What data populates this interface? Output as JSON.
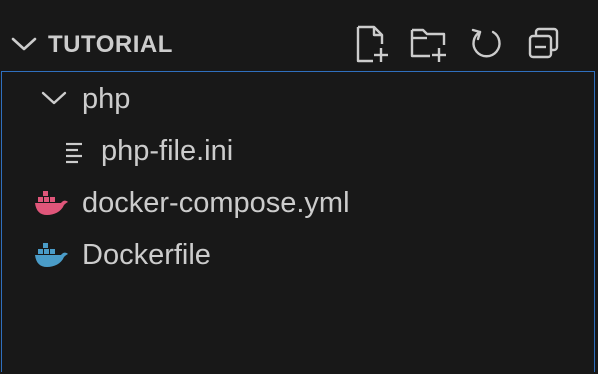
{
  "section": {
    "title": "TUTORIAL",
    "expanded": true
  },
  "toolbar": {
    "actions": [
      {
        "name": "new-file",
        "icon": "new-file-icon"
      },
      {
        "name": "new-folder",
        "icon": "new-folder-icon"
      },
      {
        "name": "refresh",
        "icon": "refresh-icon"
      },
      {
        "name": "collapse-all",
        "icon": "collapse-all-icon"
      }
    ]
  },
  "tree": {
    "items": [
      {
        "label": "php",
        "type": "folder",
        "expanded": true,
        "icon": "chevron-down-icon"
      },
      {
        "label": "php-file.ini",
        "type": "file",
        "icon": "ini-file-icon"
      },
      {
        "label": "docker-compose.yml",
        "type": "file",
        "icon": "docker-compose-icon",
        "icon_color": "#e0567a"
      },
      {
        "label": "Dockerfile",
        "type": "file",
        "icon": "docker-icon",
        "icon_color": "#4a9cc8"
      }
    ]
  },
  "colors": {
    "background": "#181818",
    "text": "#cccccc",
    "focus_border": "#2f6fbe",
    "docker_compose": "#e0567a",
    "docker": "#4a9cc8"
  }
}
